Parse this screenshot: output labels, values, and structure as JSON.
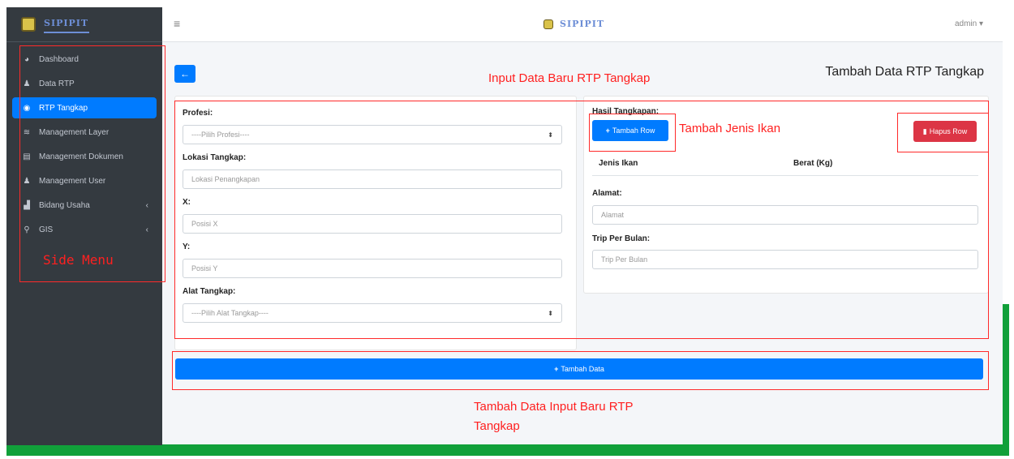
{
  "brand": {
    "name": "SIPIPIT",
    "logo_icon": "shield-logo-icon"
  },
  "topbar": {
    "user_label": "admin ▾"
  },
  "sidebar": {
    "items": [
      {
        "label": "Dashboard",
        "icon": "dashboard-icon",
        "glyph": "◕",
        "active": false
      },
      {
        "label": "Data RTP",
        "icon": "user-icon",
        "glyph": "♟",
        "active": false
      },
      {
        "label": "RTP Tangkap",
        "icon": "circle-icon",
        "glyph": "◉",
        "active": true
      },
      {
        "label": "Management Layer",
        "icon": "layers-icon",
        "glyph": "≋",
        "active": false
      },
      {
        "label": "Management Dokumen",
        "icon": "document-icon",
        "glyph": "▤",
        "active": false
      },
      {
        "label": "Management User",
        "icon": "user-icon",
        "glyph": "♟",
        "active": false
      },
      {
        "label": "Bidang Usaha",
        "icon": "chart-icon",
        "glyph": "▟",
        "active": false,
        "chevron": "‹"
      },
      {
        "label": "GIS",
        "icon": "map-marker-icon",
        "glyph": "⚲",
        "active": false,
        "chevron": "‹"
      }
    ]
  },
  "page": {
    "title": "Tambah Data RTP Tangkap"
  },
  "form_left": {
    "profesi_label": "Profesi:",
    "profesi_value": "----Pilih Profesi----",
    "lokasi_label": "Lokasi Tangkap:",
    "lokasi_placeholder": "Lokasi Penangkapan",
    "x_label": "X:",
    "x_placeholder": "Posisi X",
    "y_label": "Y:",
    "y_placeholder": "Posisi Y",
    "alat_label": "Alat Tangkap:",
    "alat_value": "----Pilih Alat Tangkap----"
  },
  "form_right": {
    "hasil_label": "Hasil Tangkapan:",
    "tambah_row_label": "Tambah Row",
    "hapus_row_label": "Hapus Row",
    "col_jenis": "Jenis Ikan",
    "col_berat": "Berat (Kg)",
    "alamat_label": "Alamat:",
    "alamat_placeholder": "Alamat",
    "trip_label": "Trip Per Bulan:",
    "trip_placeholder": "Trip Per Bulan"
  },
  "submit": {
    "label": "Tambah Data"
  },
  "annotations": {
    "side_menu": "Side Menu",
    "input_data": "Input Data Baru RTP Tangkap",
    "tambah_jenis": "Tambah Jenis Ikan",
    "tambah_data_line1": "Tambah Data Input Baru RTP",
    "tambah_data_line2": "Tangkap"
  },
  "colors": {
    "accent": "#007bff",
    "danger": "#dc3545",
    "sidebar": "#343a40",
    "frame": "#11a03a",
    "annotation": "#ff2020"
  }
}
